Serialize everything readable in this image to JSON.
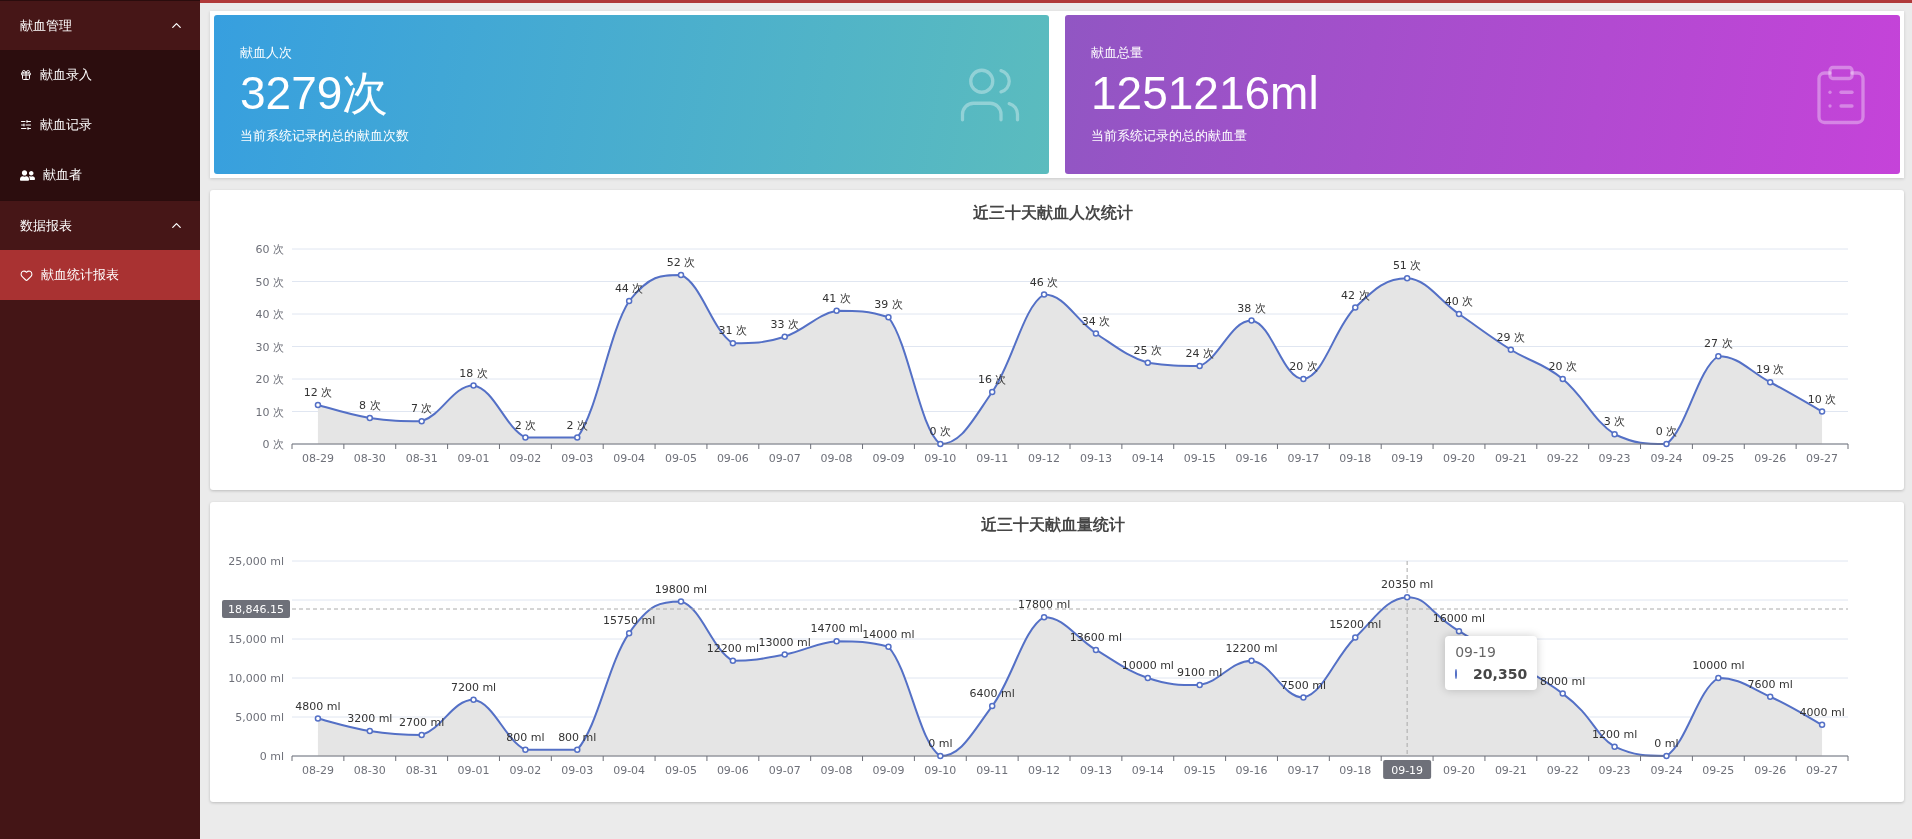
{
  "sidebar": {
    "groups": [
      {
        "title": "献血管理",
        "expanded": true,
        "items": [
          {
            "label": "献血录入",
            "kind": "gift",
            "selected": false
          },
          {
            "label": "献血记录",
            "kind": "sliders",
            "selected": false
          },
          {
            "label": "献血者",
            "kind": "users",
            "selected": false
          }
        ]
      },
      {
        "title": "数据报表",
        "expanded": true,
        "items": [
          {
            "label": "献血统计报表",
            "kind": "heart",
            "selected": true
          }
        ]
      }
    ]
  },
  "stats": [
    {
      "kind": "people",
      "label": "献血人次",
      "value": "3279次",
      "caption": "当前系统记录的总的献血次数"
    },
    {
      "kind": "clipboard",
      "label": "献血总量",
      "value": "1251216ml",
      "caption": "当前系统记录的总的献血量"
    }
  ],
  "charts": [
    {
      "chart_data": {
        "type": "area",
        "title": "近三十天献血人次统计",
        "categories": [
          "08-29",
          "08-30",
          "08-31",
          "09-01",
          "09-02",
          "09-03",
          "09-04",
          "09-05",
          "09-06",
          "09-07",
          "09-08",
          "09-09",
          "09-10",
          "09-11",
          "09-12",
          "09-13",
          "09-14",
          "09-15",
          "09-16",
          "09-17",
          "09-18",
          "09-19",
          "09-20",
          "09-21",
          "09-22",
          "09-23",
          "09-24",
          "09-25",
          "09-26",
          "09-27"
        ],
        "grid": true,
        "series": [
          {
            "color": "#5470c6",
            "values": [
              12,
              8,
              7,
              18,
              2,
              2,
              44,
              52,
              31,
              33,
              41,
              39,
              0,
              16,
              46,
              34,
              25,
              24,
              38,
              20,
              42,
              51,
              40,
              29,
              20,
              3,
              0,
              27,
              19,
              10
            ]
          }
        ],
        "ylim": [
          0,
          60
        ],
        "yticks": [
          {
            "value": 0,
            "label": "0 次"
          },
          {
            "value": 10,
            "label": "10 次"
          },
          {
            "value": 20,
            "label": "20 次"
          },
          {
            "value": 30,
            "label": "30 次"
          },
          {
            "value": 40,
            "label": "40 次"
          },
          {
            "value": 50,
            "label": "50 次"
          },
          {
            "value": 60,
            "label": "60 次"
          }
        ],
        "value_labels": [
          "12 次",
          "8 次",
          "7 次",
          "18 次",
          "2 次",
          "2 次",
          "44 次",
          "52 次",
          "31 次",
          "33 次",
          "41 次",
          "39 次",
          "0 次",
          "16 次",
          "46 次",
          "34 次",
          "25 次",
          "24 次",
          "38 次",
          "20 次",
          "42 次",
          "51 次",
          "40 次",
          "29 次",
          "20 次",
          "3 次",
          "0 次",
          "27 次",
          "19 次",
          "10 次"
        ]
      }
    },
    {
      "chart_data": {
        "type": "area",
        "title": "近三十天献血量统计",
        "categories": [
          "08-29",
          "08-30",
          "08-31",
          "09-01",
          "09-02",
          "09-03",
          "09-04",
          "09-05",
          "09-06",
          "09-07",
          "09-08",
          "09-09",
          "09-10",
          "09-11",
          "09-12",
          "09-13",
          "09-14",
          "09-15",
          "09-16",
          "09-17",
          "09-18",
          "09-19",
          "09-20",
          "09-21",
          "09-22",
          "09-23",
          "09-24",
          "09-25",
          "09-26",
          "09-27"
        ],
        "grid": true,
        "series": [
          {
            "color": "#5470c6",
            "values": [
              4800,
              3200,
              2700,
              7200,
              800,
              800,
              15750,
              19800,
              12200,
              13000,
              14700,
              14000,
              0,
              6400,
              17800,
              13600,
              10000,
              9100,
              12200,
              7500,
              15200,
              20350,
              16000,
              null,
              8000,
              1200,
              0,
              10000,
              7600,
              4000
            ]
          }
        ],
        "ylim": [
          0,
          25000
        ],
        "yticks": [
          {
            "value": 0,
            "label": "0 ml"
          },
          {
            "value": 5000,
            "label": "5,000 ml"
          },
          {
            "value": 10000,
            "label": "10,000 ml"
          },
          {
            "value": 15000,
            "label": "15,000 ml"
          },
          {
            "value": 25000,
            "label": "25,000 ml"
          }
        ],
        "value_labels": [
          "4800 ml",
          "3200 ml",
          "2700 ml",
          "7200 ml",
          "800 ml",
          "800 ml",
          "15750 ml",
          "19800 ml",
          "12200 ml",
          "13000 ml",
          "14700 ml",
          "14000 ml",
          "0 ml",
          "6400 ml",
          "17800 ml",
          "13600 ml",
          "10000 ml",
          "9100 ml",
          "12200 ml",
          "7500 ml",
          "15200 ml",
          "20350 ml",
          "16000 ml",
          null,
          "8000 ml",
          "1200 ml",
          "0 ml",
          "10000 ml",
          "7600 ml",
          "4000 ml"
        ],
        "ref_lines": [
          {
            "axis": "y",
            "value": 18846.15,
            "label": "18,846.15"
          },
          {
            "axis": "x",
            "value": "09-19",
            "label": "09-19"
          }
        ]
      },
      "tooltip": {
        "title": "09-19",
        "value": "20,350"
      }
    }
  ]
}
